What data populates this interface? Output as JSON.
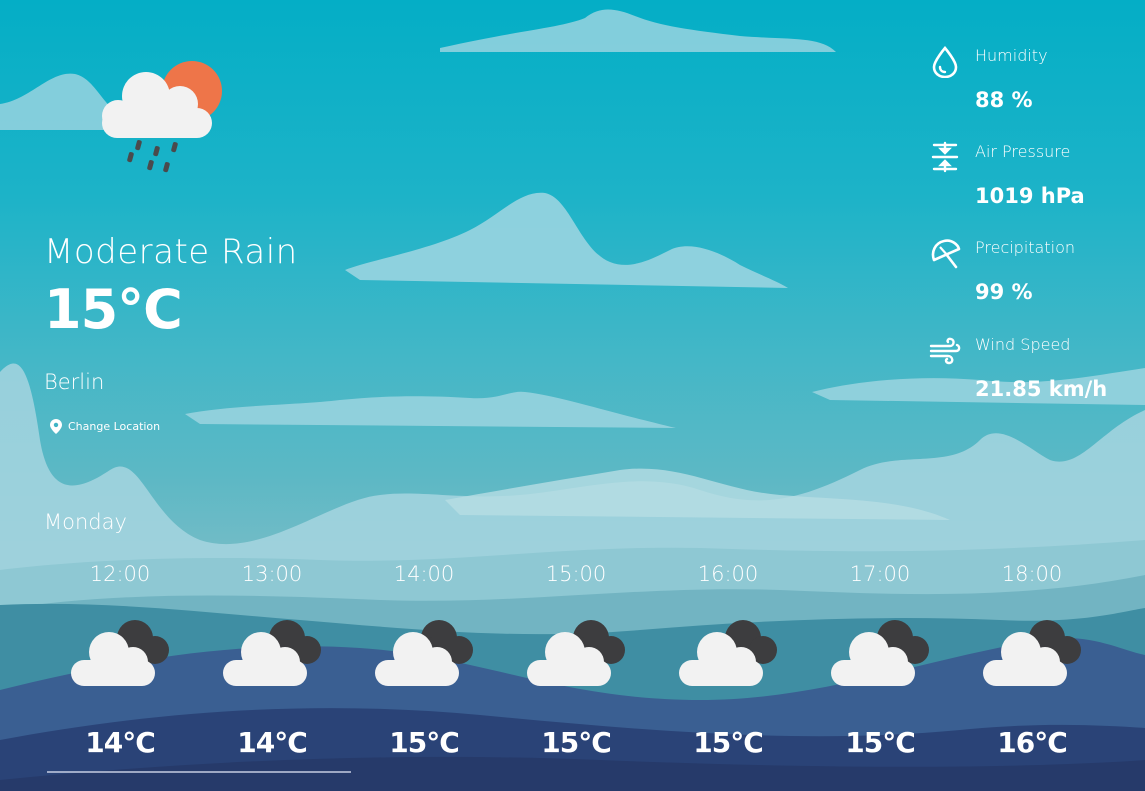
{
  "current": {
    "condition": "Moderate Rain",
    "temperature": "15°C",
    "city": "Berlin",
    "change_location_label": "Change Location",
    "day": "Monday",
    "icon": "sun-cloud-rain-icon"
  },
  "stats": [
    {
      "label": "Humidity",
      "value": "88 %",
      "icon": "water-drop-icon"
    },
    {
      "label": "Air Pressure",
      "value": "1019 hPa",
      "icon": "pressure-icon"
    },
    {
      "label": "Precipitation",
      "value": "99 %",
      "icon": "umbrella-icon"
    },
    {
      "label": "Wind Speed",
      "value": "21.85 km/h",
      "icon": "wind-icon"
    }
  ],
  "hourly": [
    {
      "time": "12:00",
      "temp": "14°C",
      "icon": "cloudy-icon"
    },
    {
      "time": "13:00",
      "temp": "14°C",
      "icon": "cloudy-icon"
    },
    {
      "time": "14:00",
      "temp": "15°C",
      "icon": "cloudy-icon"
    },
    {
      "time": "15:00",
      "temp": "15°C",
      "icon": "cloudy-icon"
    },
    {
      "time": "16:00",
      "temp": "15°C",
      "icon": "cloudy-icon"
    },
    {
      "time": "17:00",
      "temp": "15°C",
      "icon": "cloudy-icon"
    },
    {
      "time": "18:00",
      "temp": "16°C",
      "icon": "cloudy-icon"
    }
  ],
  "colors": {
    "sky_top": "#04aec6",
    "sun": "#ee7549",
    "cloud_white": "#f2f2f2",
    "cloud_dark": "#3d3d3f",
    "hill_dark": "#2a4377"
  }
}
